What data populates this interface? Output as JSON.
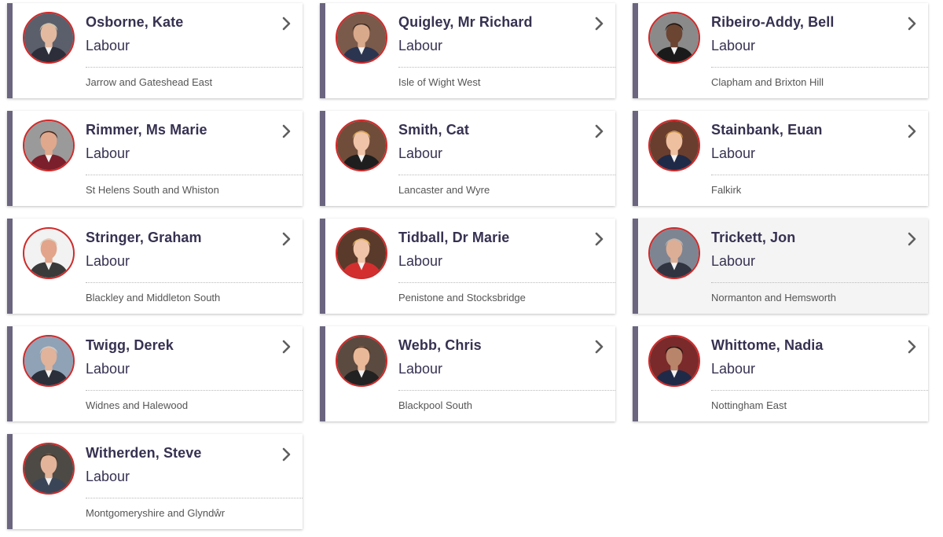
{
  "colors": {
    "accent_border": "#6b6580",
    "photo_ring": "#d12a2a",
    "text_primary": "#373151",
    "text_secondary": "#555555"
  },
  "members": [
    {
      "name": "Osborne, Kate",
      "party": "Labour",
      "constituency": "Jarrow and Gateshead East",
      "photo": {
        "bg": "#5a5f6b",
        "skin": "#e3b9a0",
        "hair": "#cfc3a8",
        "top": "#2c2f3a"
      }
    },
    {
      "name": "Quigley, Mr Richard",
      "party": "Labour",
      "constituency": "Isle of Wight West",
      "photo": {
        "bg": "#7a5a4a",
        "skin": "#d9a98c",
        "hair": "#3b2a22",
        "top": "#2b3550"
      }
    },
    {
      "name": "Ribeiro-Addy, Bell",
      "party": "Labour",
      "constituency": "Clapham and Brixton Hill",
      "photo": {
        "bg": "#8a8a8a",
        "skin": "#6b4432",
        "hair": "#1c1410",
        "top": "#1a1a1a"
      }
    },
    {
      "name": "Rimmer, Ms Marie",
      "party": "Labour",
      "constituency": "St Helens South and Whiston",
      "photo": {
        "bg": "#9a9a9a",
        "skin": "#e0a88c",
        "hair": "#4a2a1e",
        "top": "#7a1f2b"
      }
    },
    {
      "name": "Smith, Cat",
      "party": "Labour",
      "constituency": "Lancaster and Wyre",
      "photo": {
        "bg": "#6f4d3a",
        "skin": "#f0c4a8",
        "hair": "#d8a24e",
        "top": "#1e1e1e"
      }
    },
    {
      "name": "Stainbank, Euan",
      "party": "Labour",
      "constituency": "Falkirk",
      "photo": {
        "bg": "#6a3e2e",
        "skin": "#efc0a0",
        "hair": "#c8903e",
        "top": "#1f2a48"
      }
    },
    {
      "name": "Stringer, Graham",
      "party": "Labour",
      "constituency": "Blackley and Middleton South",
      "photo": {
        "bg": "#f2f2f2",
        "skin": "#e2a48a",
        "hair": "#d9d3c4",
        "top": "#3a3a3a"
      }
    },
    {
      "name": "Tidball, Dr Marie",
      "party": "Labour",
      "constituency": "Penistone and Stocksbridge",
      "photo": {
        "bg": "#5a3a2a",
        "skin": "#f0c4a8",
        "hair": "#e0b25a",
        "top": "#d32f2f"
      }
    },
    {
      "name": "Trickett, Jon",
      "party": "Labour",
      "constituency": "Normanton and Hemsworth",
      "photo": {
        "bg": "#7d8592",
        "skin": "#dcae96",
        "hair": "#b5b5b5",
        "top": "#2f3440"
      }
    },
    {
      "name": "Twigg, Derek",
      "party": "Labour",
      "constituency": "Widnes and Halewood",
      "photo": {
        "bg": "#8fa2b6",
        "skin": "#e0b39a",
        "hair": "#c9c9c9",
        "top": "#2a2f3a"
      }
    },
    {
      "name": "Webb, Chris",
      "party": "Labour",
      "constituency": "Blackpool South",
      "photo": {
        "bg": "#5b4a40",
        "skin": "#e9b898",
        "hair": "#5a3a24",
        "top": "#222222"
      }
    },
    {
      "name": "Whittome, Nadia",
      "party": "Labour",
      "constituency": "Nottingham East",
      "photo": {
        "bg": "#7a2a2a",
        "skin": "#b9856a",
        "hair": "#1e1612",
        "top": "#1f2a48"
      }
    },
    {
      "name": "Witherden, Steve",
      "party": "Labour",
      "constituency": "Montgomeryshire and Glyndŵr",
      "photo": {
        "bg": "#4d4a45",
        "skin": "#e3b49a",
        "hair": "#4a3424",
        "top": "#3a4658"
      }
    }
  ]
}
